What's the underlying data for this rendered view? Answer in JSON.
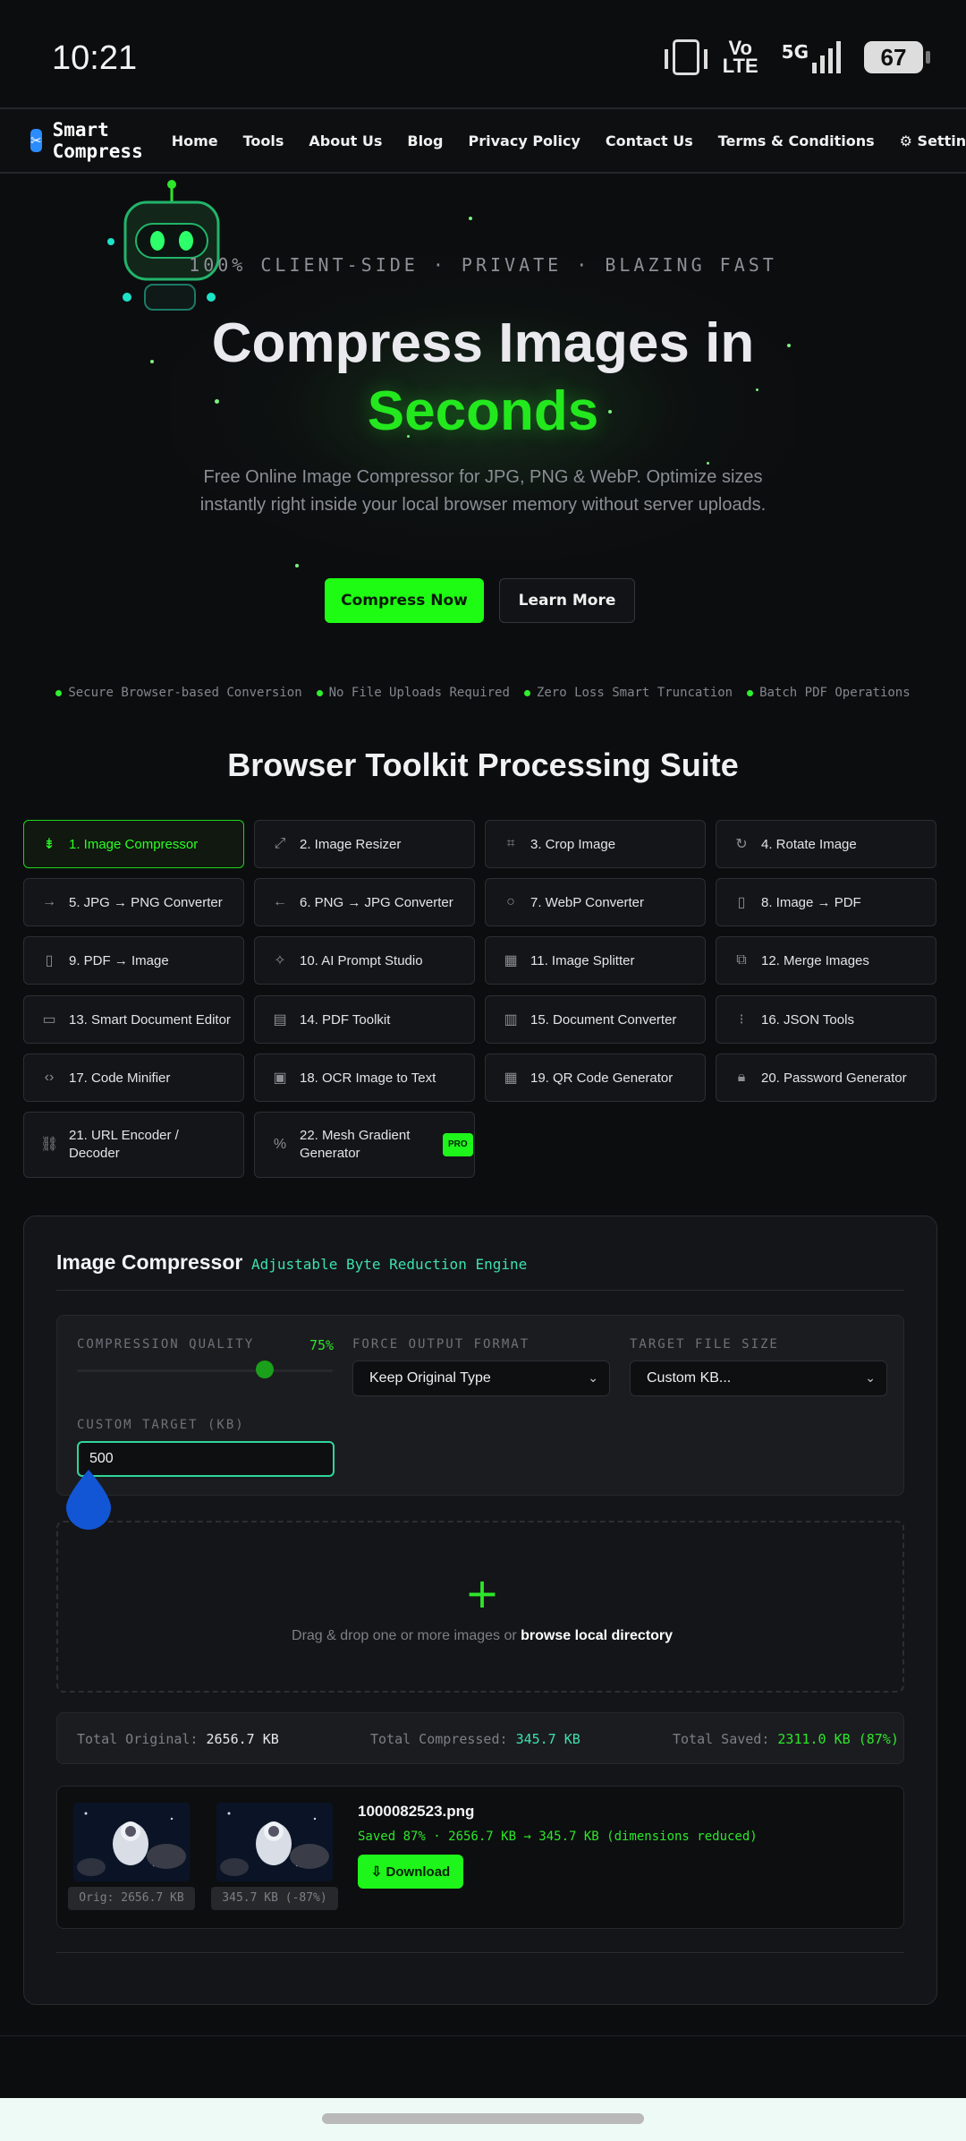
{
  "status_bar": {
    "time": "10:21",
    "volte": "Vo\nLTE",
    "network": "5G",
    "battery": "67"
  },
  "nav": {
    "brand": "Smart Compress",
    "logo_glyph": "✂",
    "links": [
      "Home",
      "Tools",
      "About Us",
      "Blog",
      "Privacy Policy",
      "Contact Us",
      "Terms & Conditions",
      "⚙ Settings"
    ]
  },
  "hero": {
    "tagline": "100% CLIENT-SIDE · PRIVATE · BLAZING FAST",
    "title_line1": "Compress Images in",
    "title_line2": "Seconds",
    "description": "Free Online Image Compressor for JPG, PNG & WebP. Optimize sizes instantly right inside your local browser memory without server uploads.",
    "primary_button": "Compress Now",
    "secondary_button": "Learn More"
  },
  "features": [
    "Secure Browser-based Conversion",
    "No File Uploads Required",
    "Zero Loss Smart Truncation",
    "Batch PDF Operations"
  ],
  "suite_title": "Browser Toolkit Processing Suite",
  "tools": [
    {
      "label": "1. Image Compressor",
      "icon": "⇟"
    },
    {
      "label": "2. Image Resizer",
      "icon": "⤢"
    },
    {
      "label": "3. Crop Image",
      "icon": "⌗"
    },
    {
      "label": "4. Rotate Image",
      "icon": "↻"
    },
    {
      "label": "5. JPG → PNG Converter",
      "icon": "→"
    },
    {
      "label": "6. PNG → JPG Converter",
      "icon": "←"
    },
    {
      "label": "7. WebP Converter",
      "icon": "○"
    },
    {
      "label": "8. Image → PDF",
      "icon": "▯"
    },
    {
      "label": "9. PDF → Image",
      "icon": "▯"
    },
    {
      "label": "10. AI Prompt Studio",
      "icon": "✧"
    },
    {
      "label": "11. Image Splitter",
      "icon": "▦"
    },
    {
      "label": "12. Merge Images",
      "icon": "⧉"
    },
    {
      "label": "13. Smart Document Editor",
      "icon": "▭"
    },
    {
      "label": "14. PDF Toolkit",
      "icon": "▤"
    },
    {
      "label": "15. Document Converter",
      "icon": "▥"
    },
    {
      "label": "16. JSON Tools",
      "icon": "⁝"
    },
    {
      "label": "17. Code Minifier",
      "icon": "‹›"
    },
    {
      "label": "18. OCR Image to Text",
      "icon": "▣"
    },
    {
      "label": "19. QR Code Generator",
      "icon": "▦"
    },
    {
      "label": "20. Password Generator",
      "icon": "🔒︎"
    },
    {
      "label": "21. URL Encoder / Decoder",
      "icon": "⛓"
    },
    {
      "label": "22. Mesh Gradient Generator",
      "icon": "%",
      "badge": "PRO"
    }
  ],
  "compressor": {
    "title": "Image Compressor",
    "subtitle": "Adjustable Byte Reduction Engine",
    "quality_label": "COMPRESSION QUALITY",
    "quality_value": "75%",
    "quality_fraction": 0.75,
    "format_label": "FORCE OUTPUT FORMAT",
    "format_value": "Keep Original Type",
    "target_label": "TARGET FILE SIZE",
    "target_value": "Custom KB...",
    "custom_label": "CUSTOM TARGET (KB)",
    "custom_value": "500",
    "dropzone_text": "Drag & drop one or more images or ",
    "dropzone_link": "browse local directory",
    "totals": {
      "original_label": "Total Original:",
      "original_value": "2656.7 KB",
      "compressed_label": "Total Compressed:",
      "compressed_value": "345.7 KB",
      "saved_label": "Total Saved:",
      "saved_value": "2311.0 KB (87%)"
    },
    "result": {
      "filename": "1000082523.png",
      "summary": "Saved 87% · 2656.7 KB → 345.7 KB (dimensions reduced)",
      "orig_caption": "Orig: 2656.7 KB",
      "new_caption": "345.7 KB (-87%)",
      "download_label": "⇩ Download"
    }
  },
  "colors": {
    "accent": "#1efc14",
    "teal": "#3de0b0",
    "background": "#0c0d0f"
  }
}
